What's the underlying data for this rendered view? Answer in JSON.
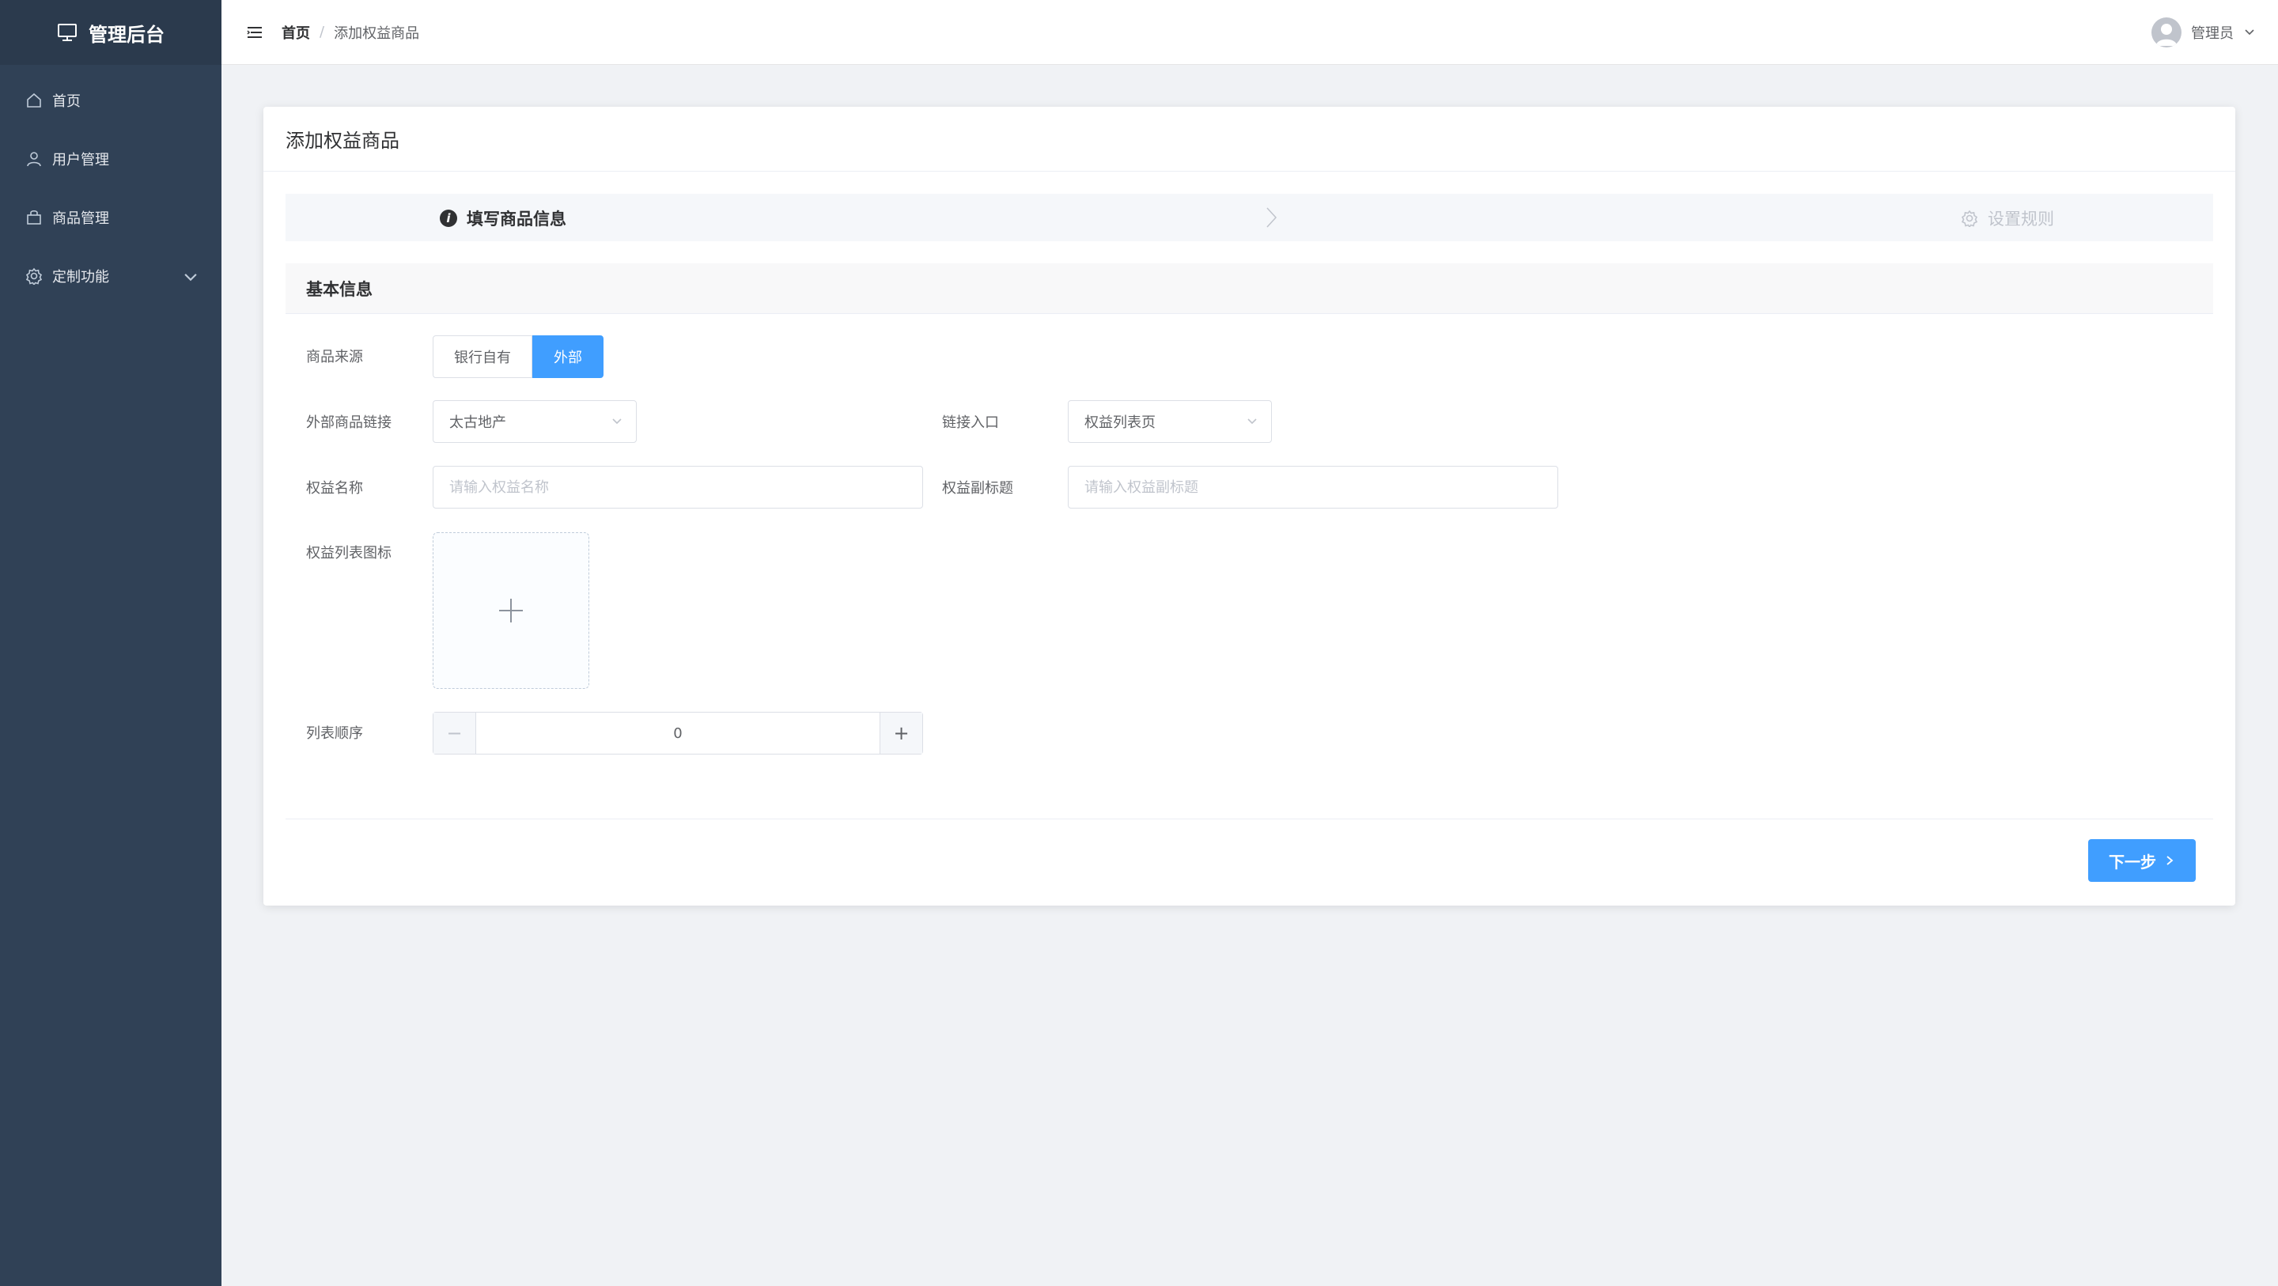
{
  "app": {
    "title": "管理后台"
  },
  "sidebar": {
    "items": [
      {
        "label": "首页",
        "icon": "home-icon"
      },
      {
        "label": "用户管理",
        "icon": "user-icon"
      },
      {
        "label": "商品管理",
        "icon": "bag-icon"
      },
      {
        "label": "定制功能",
        "icon": "gear-icon"
      }
    ]
  },
  "header": {
    "breadcrumb": [
      "首页",
      "添加权益商品"
    ],
    "separator": "/",
    "user": "管理员"
  },
  "card": {
    "title": "添加权益商品",
    "steps": [
      {
        "label": "填写商品信息",
        "status": "active"
      },
      {
        "label": "设置规则",
        "status": "pending"
      }
    ],
    "section_title": "基本信息"
  },
  "form": {
    "source": {
      "label": "商品来源",
      "options": [
        "银行自有",
        "外部"
      ],
      "selected": "外部"
    },
    "external_link": {
      "label": "外部商品链接",
      "value": "太古地产"
    },
    "link_entry": {
      "label": "链接入口",
      "value": "权益列表页"
    },
    "name": {
      "label": "权益名称",
      "placeholder": "请输入权益名称"
    },
    "subtitle": {
      "label": "权益副标题",
      "placeholder": "请输入权益副标题"
    },
    "icon": {
      "label": "权益列表图标"
    },
    "order": {
      "label": "列表顺序",
      "value": "0",
      "minus": "−",
      "plus": "+"
    }
  },
  "actions": {
    "next_label": "下一步"
  },
  "colors": {
    "sidebar": "#304156",
    "logo_bg": "#2b3a4d",
    "primary": "#409eff"
  }
}
